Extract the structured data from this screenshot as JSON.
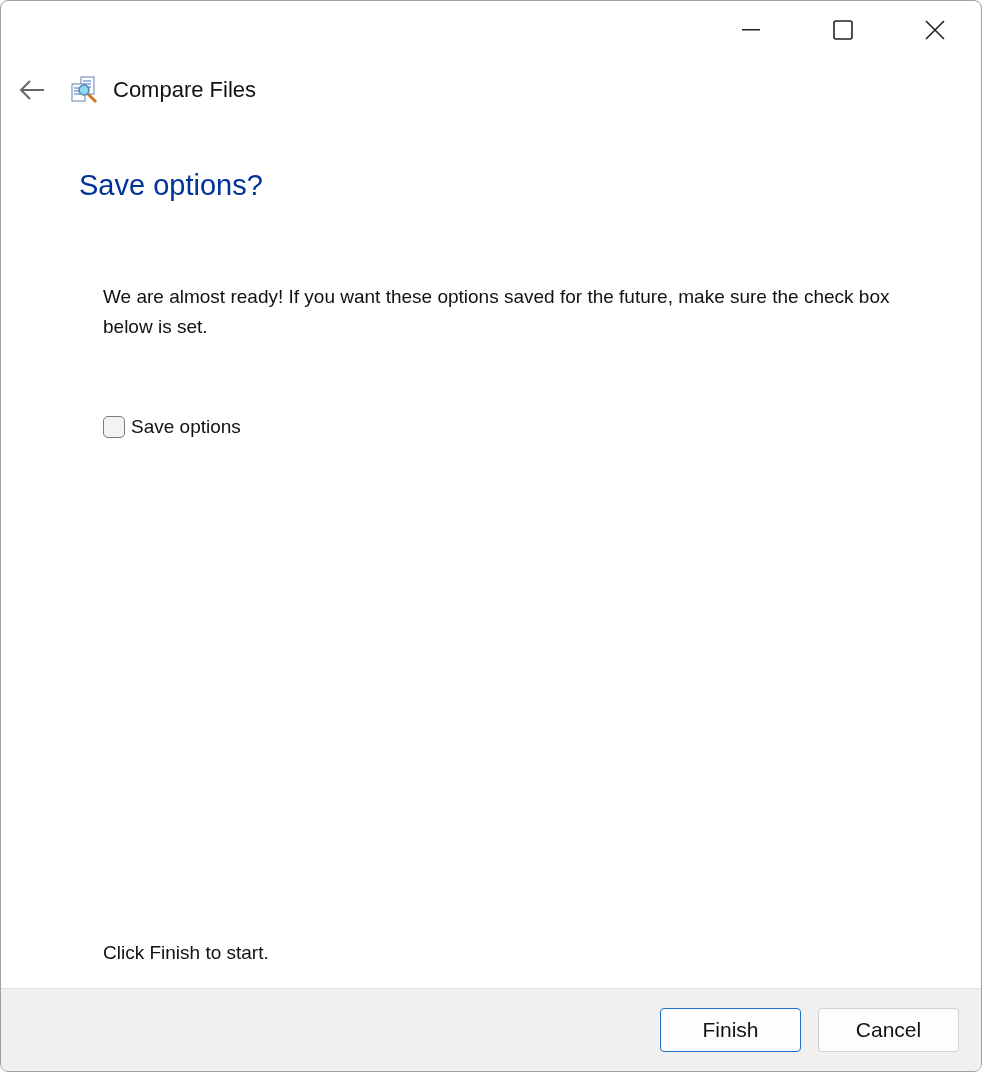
{
  "header": {
    "title": "Compare Files"
  },
  "heading": "Save options?",
  "description": "We are almost ready! If you want these options saved for the future, make sure the check box below is set.",
  "checkbox": {
    "label": "Save options",
    "checked": false
  },
  "footer_text": "Click Finish to start.",
  "buttons": [
    {
      "label": "Finish",
      "default": true
    },
    {
      "label": "Cancel",
      "default": false
    }
  ]
}
